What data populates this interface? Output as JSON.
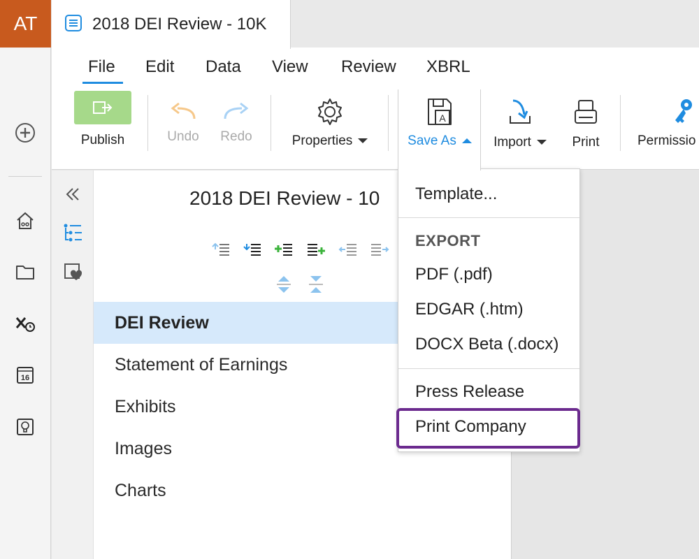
{
  "app": {
    "avatar_initials": "AT",
    "accent": "#1f8ce0",
    "avatar_color": "#c85a1e",
    "highlight_color": "#6b2a8e"
  },
  "tab": {
    "title": "2018 DEI Review - 10K",
    "icon": "document-icon"
  },
  "menu": {
    "file": "File",
    "edit": "Edit",
    "data": "Data",
    "view": "View",
    "review": "Review",
    "xbrl": "XBRL"
  },
  "toolbar": {
    "publish": "Publish",
    "undo": "Undo",
    "redo": "Redo",
    "properties": "Properties",
    "save_as": "Save As",
    "import": "Import",
    "print": "Print",
    "permissions": "Permissio"
  },
  "outline": {
    "title": "2018 DEI Review - 10",
    "items": [
      {
        "label": "DEI Review",
        "selected": true
      },
      {
        "label": "Statement of Earnings"
      },
      {
        "label": "Exhibits"
      },
      {
        "label": "Images"
      },
      {
        "label": "Charts"
      }
    ]
  },
  "dropdown": {
    "template": "Template...",
    "export_header": "EXPORT",
    "pdf": "PDF (.pdf)",
    "edgar": "EDGAR (.htm)",
    "docx": "DOCX Beta (.docx)",
    "press_release": "Press Release",
    "print_company": "Print Company"
  },
  "rail": {
    "calendar_day": "16"
  }
}
